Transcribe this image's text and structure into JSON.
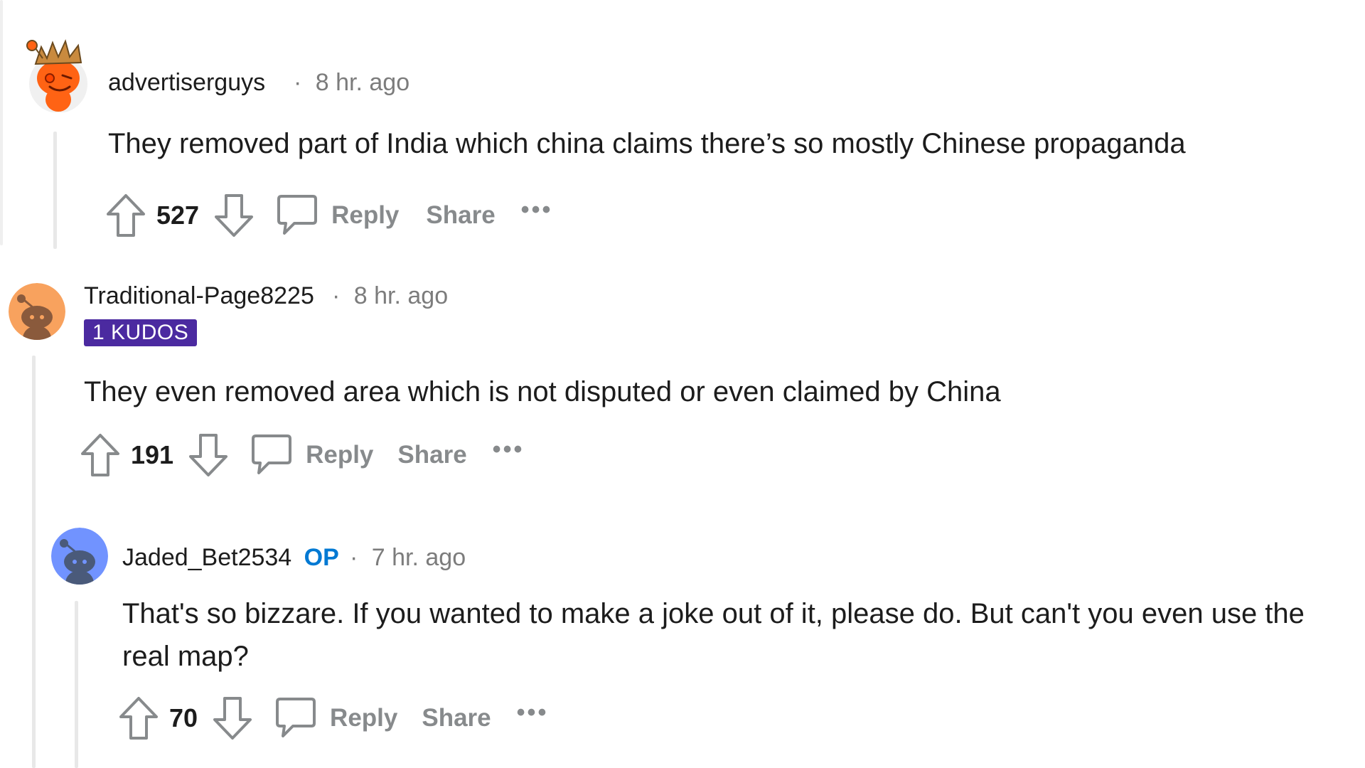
{
  "comments": [
    {
      "username": "advertiserguys",
      "separator": "·",
      "time": "8 hr. ago",
      "body": "They removed part of India which china claims there’s so mostly Chinese propaganda",
      "score": "527",
      "reply_label": "Reply",
      "share_label": "Share",
      "more_label": "•••"
    },
    {
      "username": "Traditional-Page8225",
      "separator": "·",
      "time": "8 hr. ago",
      "badge": "1 KUDOS",
      "body": "They even removed area which is not disputed or even claimed by China",
      "score": "191",
      "reply_label": "Reply",
      "share_label": "Share",
      "more_label": "•••"
    },
    {
      "username": "Jaded_Bet2534",
      "op_tag": "OP",
      "separator": "·",
      "time": "7 hr. ago",
      "body": "That's so bizzare. If you wanted to make a joke out of it, please do. But can't you even use the real map?",
      "score": "70",
      "reply_label": "Reply",
      "share_label": "Share",
      "more_label": "•••"
    }
  ],
  "colors": {
    "badge_bg": "#4b2aa0",
    "op_blue": "#0079d3",
    "muted": "#878a8c",
    "thread_line": "#e8e8e8"
  },
  "icons": [
    "upvote-icon",
    "downvote-icon",
    "comment-bubble-icon",
    "snoo-avatar-icon"
  ]
}
